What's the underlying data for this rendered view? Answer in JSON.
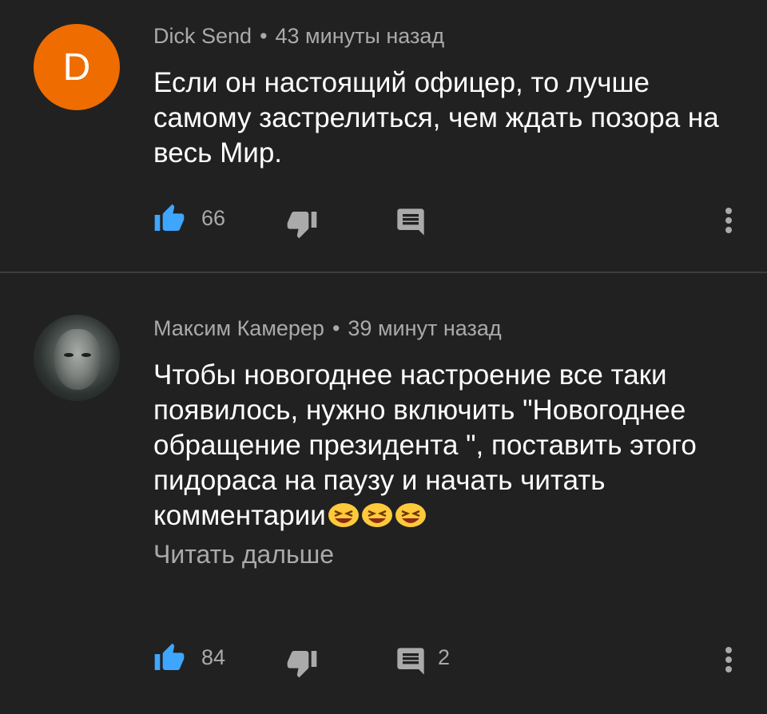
{
  "comments": [
    {
      "avatar_letter": "D",
      "author": "Dick Send",
      "separator": "•",
      "time": "43 минуты назад",
      "text": "Если он настоящий офицер, то лучше самому застрелиться, чем ждать позора на весь Мир.",
      "likes": "66",
      "replies": ""
    },
    {
      "author": "Максим Камерер",
      "separator": "•",
      "time": "39 минут назад",
      "text": "Чтобы новогоднее настроение все таки появилось, нужно включить \"Новогоднее обращение президента \", поставить этого пидораса на паузу и начать читать комментарии",
      "emoji": "😆😆😆",
      "read_more": "Читать дальше",
      "likes": "84",
      "replies": "2"
    }
  ],
  "colors": {
    "background": "#212121",
    "avatar_orange": "#ef6c00",
    "like_blue": "#3ea6ff",
    "icon_gray": "#aaaaaa",
    "secondary_text": "#aaaaaa"
  },
  "icons": [
    "thumbs-up-icon",
    "thumbs-down-icon",
    "reply-icon",
    "more-vert-icon",
    "laughing-emoji-icon"
  ]
}
